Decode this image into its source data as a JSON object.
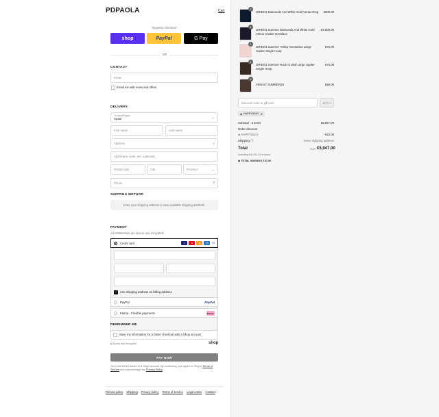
{
  "brand": {
    "logo": "PDPAOLA",
    "cart_link": "Cart"
  },
  "express": {
    "label": "Express checkout",
    "shop": "shop",
    "paypal": "PayPal",
    "gpay": "G Pay",
    "or": "OR"
  },
  "contact": {
    "title": "CONTACT",
    "email_placeholder": "Email",
    "newsletter": "Email me with news and offers"
  },
  "delivery": {
    "title": "DELIVERY",
    "country_label": "Country/Region",
    "country_value": "Spain",
    "first_name": "First name",
    "last_name": "Last name",
    "address": "Address",
    "apartment": "Apartment, suite, etc. (optional)",
    "postal": "Postal code",
    "city": "City",
    "province": "Province",
    "phone": "Phone"
  },
  "shipping": {
    "title": "SHIPPING METHOD",
    "message": "Enter your shipping address to view available shipping methods."
  },
  "payment": {
    "title": "PAYMENT",
    "subtitle": "All transactions are secure and encrypted.",
    "credit_card": "Credit card",
    "card_more": "+4",
    "billing_same": "Use shipping address as billing address",
    "paypal": "PayPal",
    "klarna": "Klarna - Flexible payments",
    "klarna_badge": "Klarna."
  },
  "remember": {
    "title": "REMEMBER ME",
    "option": "Save my information for a faster checkout with a Shop account",
    "secure": "Secure and encrypted",
    "shop": "shop"
  },
  "pay_now": "PAY NOW",
  "legal": {
    "text1": "Your info will be saved to a Shop account. By continuing, you agree to Shop's",
    "terms": "Terms of Service",
    "text2": "and acknowledge the",
    "privacy": "Privacy Policy",
    "text3": "."
  },
  "footer": [
    "Refund policy",
    "Shipping",
    "Privacy policy",
    "Terms of service",
    "Legal notice",
    "Contact"
  ],
  "items": [
    {
      "qty": "1",
      "name": "GRIDO1 Diamonds And White Gold Venus Ring",
      "price": "€500.00"
    },
    {
      "qty": "1",
      "name": "GRIDO1 Summer Diamonds And White Gold Venus Choker Necklace",
      "price": "€4,800.00"
    },
    {
      "qty": "1",
      "name": "GRIDO1 Summer Yellow Aventurine Large Jupiter Single Hoop",
      "price": "€75.00"
    },
    {
      "qty": "1",
      "name": "GRIDO1 Summer Rock Crystal Large Jupiter Single Hoop",
      "price": "€75.00"
    },
    {
      "qty": "1",
      "name": "VIDEO7 SUMMER25",
      "price": "€90.00"
    }
  ],
  "discount": {
    "placeholder": "Discount code or gift card",
    "apply": "APPLY",
    "tag": "HAPPY8DAY"
  },
  "summary": {
    "subtotal_label": "Subtotal · 5 items",
    "subtotal_value": "€5,957.00",
    "order_discount": "Order discount",
    "code": "HAPPY8DAY",
    "discount_value": "- €10.00",
    "shipping_label": "Shipping",
    "shipping_value": "Enter shipping address",
    "total_label": "Total",
    "total_currency": "EUR",
    "total_value": "€5,947.00",
    "taxes": "Including €1,032.12 in taxes",
    "savings": "TOTAL SAVINGS €10.00"
  },
  "colors": {
    "shop": "#5a31f4",
    "paypal": "#ffc439",
    "gpay": "#000000",
    "pay_now": "#808080"
  }
}
